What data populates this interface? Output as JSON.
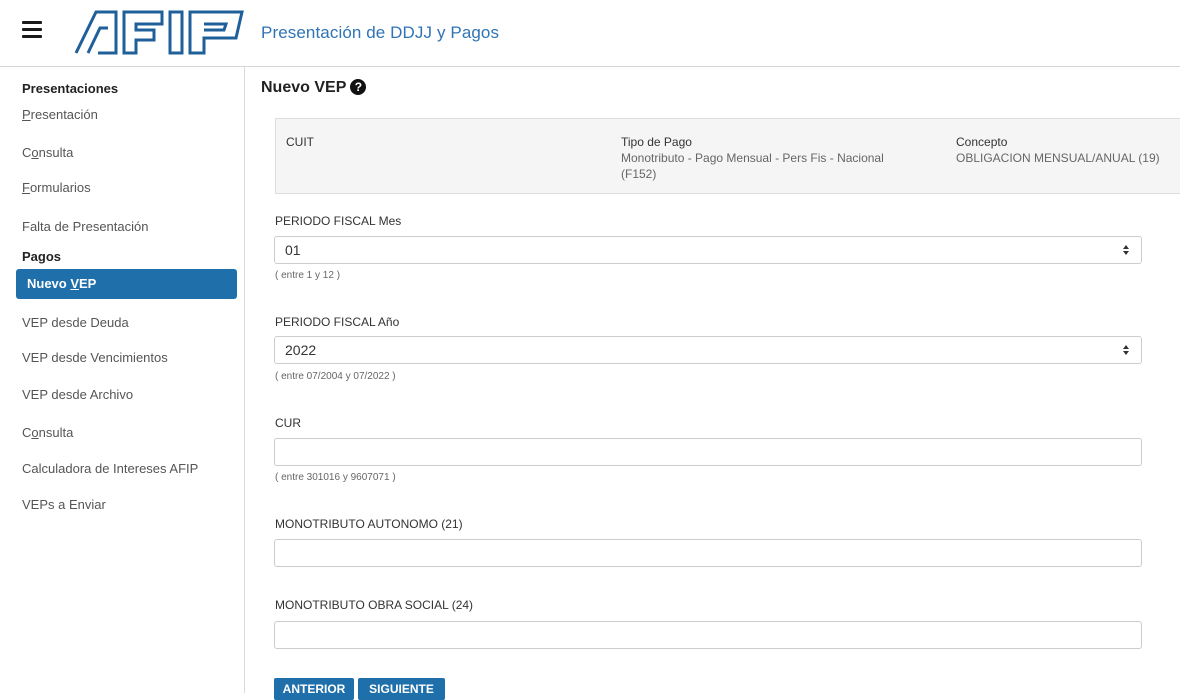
{
  "header": {
    "menu_icon": "hamburger-menu-icon",
    "logo_text": "AFIP",
    "title": "Presentación de DDJJ y Pagos"
  },
  "sidebar": {
    "presentaciones_title": "Presentaciones",
    "presentaciones_items": [
      {
        "label": "Presentación",
        "underline": "P"
      },
      {
        "label": "Consulta",
        "underline": "o"
      },
      {
        "label": "Formularios",
        "underline": "F"
      },
      {
        "label": "Falta de Presentación"
      }
    ],
    "pagos_title": "Pagos",
    "pagos_items": [
      {
        "label": "Nuevo VEP",
        "active": true,
        "underline": "V"
      },
      {
        "label": "VEP desde Deuda"
      },
      {
        "label": "VEP desde Vencimientos"
      },
      {
        "label": "VEP desde Archivo"
      },
      {
        "label": "Consulta",
        "underline": "o"
      },
      {
        "label": "Calculadora de Intereses AFIP"
      },
      {
        "label": "VEPs a Enviar"
      }
    ]
  },
  "main": {
    "title": "Nuevo VEP",
    "help_icon": "question-circle-icon",
    "info": {
      "cuit_label": "CUIT",
      "cuit_value": "",
      "tipo_label": "Tipo de Pago",
      "tipo_value_line1": "Monotributo - Pago Mensual - Pers Fis - Nacional",
      "tipo_value_line2": "(F152)",
      "concepto_label": "Concepto",
      "concepto_value": "OBLIGACION MENSUAL/ANUAL (19)"
    },
    "fields": {
      "mes_label": "PERIODO FISCAL Mes",
      "mes_value": "01",
      "mes_hint": "( entre 1 y 12 )",
      "anio_label": "PERIODO FISCAL Año",
      "anio_value": "2022",
      "anio_hint": "( entre 07/2004 y 07/2022 )",
      "cur_label": "CUR",
      "cur_value": "",
      "cur_hint": "( entre 301016 y 9607071 )",
      "autonomo_label": "MONOTRIBUTO AUTONOMO (21)",
      "autonomo_value": "",
      "obra_social_label": "MONOTRIBUTO OBRA SOCIAL (24)",
      "obra_social_value": ""
    },
    "buttons": {
      "anterior": "ANTERIOR",
      "siguiente": "SIGUIENTE"
    }
  },
  "colors": {
    "accent": "#1f6fab",
    "header_title": "#2f74b5"
  }
}
